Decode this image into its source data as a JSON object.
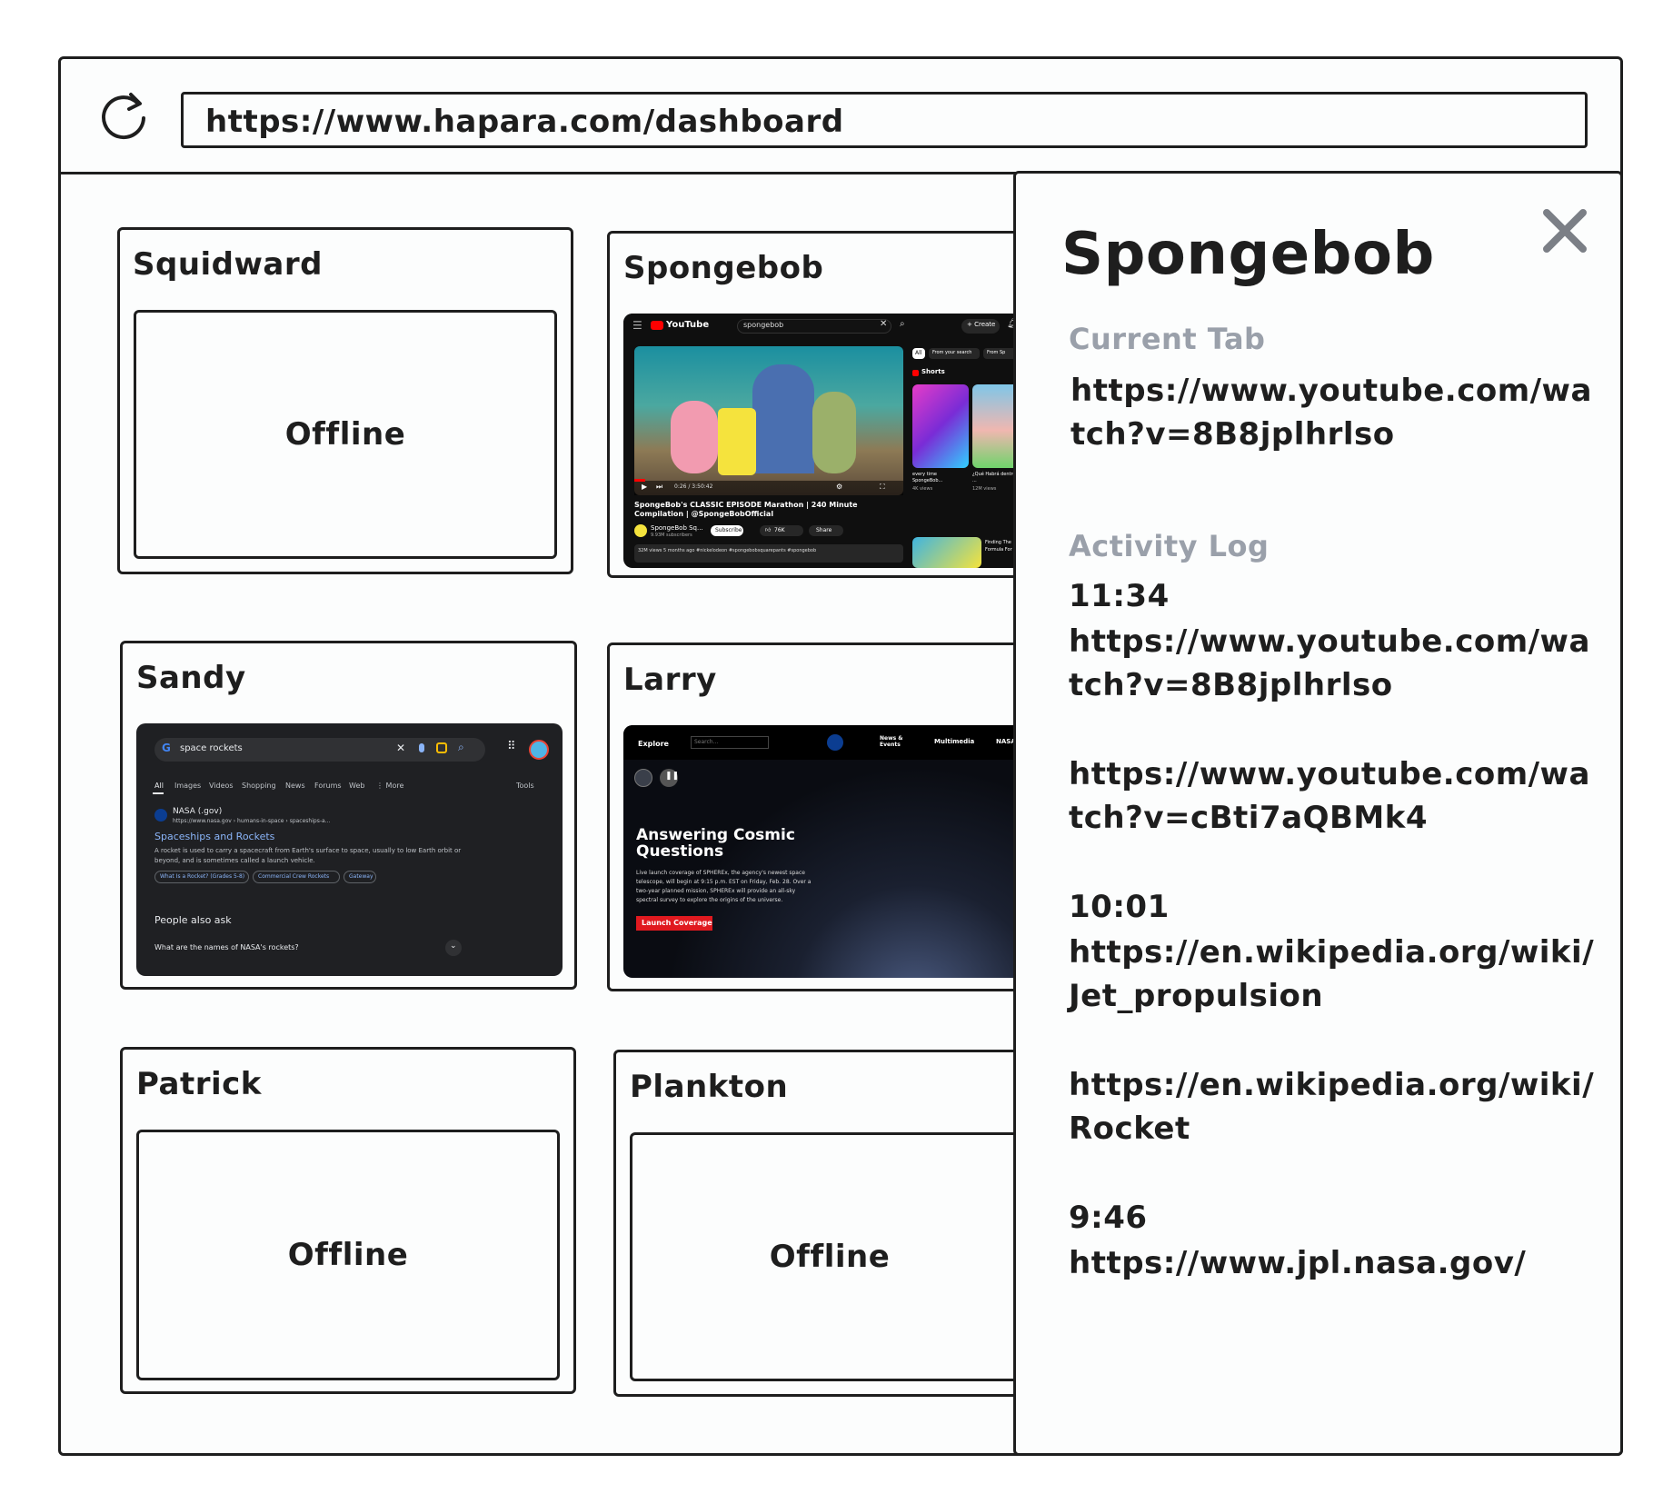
{
  "browser": {
    "url": "https://www.hapara.com/dashboard"
  },
  "students": [
    {
      "name": "Squidward",
      "status": "Offline"
    },
    {
      "name": "Spongebob"
    },
    {
      "name": "Sandy"
    },
    {
      "name": "Larry"
    },
    {
      "name": "Patrick",
      "status": "Offline"
    },
    {
      "name": "Plankton",
      "status": "Offline"
    }
  ],
  "thumbnails": {
    "spongebob": {
      "logo": "YouTube",
      "search": "spongebob",
      "create": "+ Create",
      "chips": [
        "All",
        "From your search",
        "From Sp"
      ],
      "shorts": "Shorts",
      "video_title": "SpongeBob's CLASSIC EPISODE Marathon | 240 Minute Compilation | @SpongeBobOfficial",
      "channel": "SpongeBob Sq...",
      "subscribers": "9.93M subscribers",
      "subscribe": "Subscribe",
      "likes": "76K",
      "share": "Share",
      "views": "32M views  5 months ago  #nickelodeon #spongebobsquarepants #spongebob",
      "time": "0:26 / 3:50:42",
      "short1": "every time SpongeBob...",
      "short1_views": "4K views",
      "short2": "¿Qué Habrá dentro de ...",
      "short2_views": "12M views",
      "rec": "Finding The Formula For"
    },
    "sandy": {
      "query": "space rockets",
      "tabs": [
        "All",
        "Images",
        "Videos",
        "Shopping",
        "News",
        "Forums",
        "Web",
        "⋮ More"
      ],
      "tools": "Tools",
      "source": "NASA (.gov)",
      "source_url": "https://www.nasa.gov › humans-in-space › spaceships-a...",
      "result_title": "Spaceships and Rockets",
      "snippet_line1": "A rocket is used to carry a spacecraft from Earth's surface to space, usually to low Earth orbit or",
      "snippet_line2": "beyond, and is sometimes called a launch vehicle.",
      "links": [
        "What Is a Rocket? (Grades 5-8)",
        "Commercial Crew Rockets",
        "Gateway"
      ],
      "paa": "People also ask",
      "question": "What are the names of NASA's rockets?"
    },
    "larry": {
      "explore": "Explore",
      "search": "Search...",
      "nav": [
        "News & Events",
        "Multimedia",
        "NASA"
      ],
      "headline": "Answering Cosmic Questions",
      "body": "Live launch coverage of SPHEREx, the agency's newest space telescope, will begin at 9:15 p.m. EST on Friday, Feb. 28. Over a two-year planned mission, SPHEREx will provide an all-sky spectral survey to explore the origins of the universe.",
      "cta": "Launch Coverage"
    }
  },
  "panel": {
    "title": "Spongebob",
    "current_tab_label": "Current Tab",
    "current_tab": "https://www.youtube.com/wa\ntch?v=8B8jplhrlso",
    "activity_label": "Activity Log",
    "log": [
      {
        "time": "11:34",
        "url": "https://www.youtube.com/wa\ntch?v=8B8jplhrlso"
      },
      {
        "url": "https://www.youtube.com/wa\ntch?v=cBti7aQBMk4"
      },
      {
        "time": "10:01",
        "url": "https://en.wikipedia.org/wiki/\nJet_propulsion"
      },
      {
        "url": "https://en.wikipedia.org/wiki/\nRocket"
      },
      {
        "time": "9:46",
        "url": "https://www.jpl.nasa.gov/"
      }
    ]
  },
  "colors": {
    "ink": "#1e1e1e",
    "muted": "#9aa0aa",
    "youtube_red": "#ff0000",
    "link_blue": "#8ab4f8",
    "nasa_red": "#e0191f"
  }
}
